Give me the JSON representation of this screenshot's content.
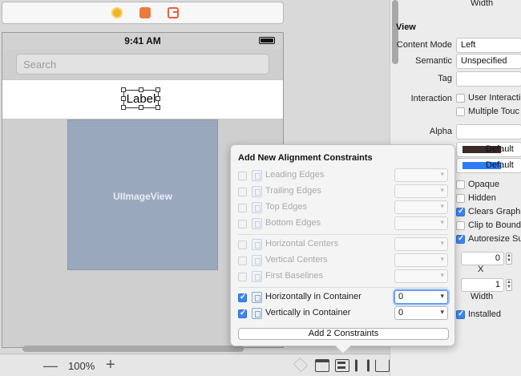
{
  "canvas": {
    "device": {
      "status_time": "9:41 AM",
      "search_placeholder": "Search",
      "label_text": "Label",
      "imageview_text": "UIImageView"
    },
    "dock_icons": [
      "view-controller-icon",
      "first-responder-icon",
      "exit-icon"
    ],
    "bottom_bar": {
      "zoom_minus": "—",
      "zoom_level": "100%",
      "zoom_plus": "+"
    }
  },
  "popover": {
    "title": "Add New Alignment Constraints",
    "edge_rows": [
      {
        "label": "Leading Edges",
        "checked": false,
        "enabled": false
      },
      {
        "label": "Trailing Edges",
        "checked": false,
        "enabled": false
      },
      {
        "label": "Top Edges",
        "checked": false,
        "enabled": false
      },
      {
        "label": "Bottom Edges",
        "checked": false,
        "enabled": false
      }
    ],
    "center_rows": [
      {
        "label": "Horizontal Centers",
        "checked": false,
        "enabled": false
      },
      {
        "label": "Vertical Centers",
        "checked": false,
        "enabled": false
      },
      {
        "label": "First Baselines",
        "checked": false,
        "enabled": false
      }
    ],
    "container_rows": [
      {
        "label": "Horizontally in Container",
        "checked": true,
        "enabled": true,
        "value": "0"
      },
      {
        "label": "Vertically in Container",
        "checked": true,
        "enabled": true,
        "value": "0"
      }
    ],
    "add_button": "Add 2 Constraints"
  },
  "inspector": {
    "top_caption": "Width",
    "section": "View",
    "content_mode_label": "Content Mode",
    "content_mode_value": "Left",
    "semantic_label": "Semantic",
    "semantic_value": "Unspecified",
    "tag_label": "Tag",
    "interaction_label": "Interaction",
    "user_interaction": "User Interacti",
    "multiple_touch": "Multiple Touc",
    "alpha_label": "Alpha",
    "background_value": "Default",
    "tint_value": "Default",
    "drawing": [
      {
        "label": "Opaque",
        "checked": false
      },
      {
        "label": "Hidden",
        "checked": false
      },
      {
        "label": "Clears Graphi",
        "checked": true
      },
      {
        "label": "Clip to Bound",
        "checked": false
      },
      {
        "label": "Autoresize Su",
        "checked": true
      }
    ],
    "stretch_x_value": "0",
    "stretch_x_caption": "X",
    "stretch_w_value": "1",
    "stretch_w_caption": "Width",
    "installed_label": "Installed",
    "colors": {
      "background_swatch": "#3a2a28",
      "tint_swatch": "#2d7cf6",
      "accent": "#3c86f2"
    }
  }
}
